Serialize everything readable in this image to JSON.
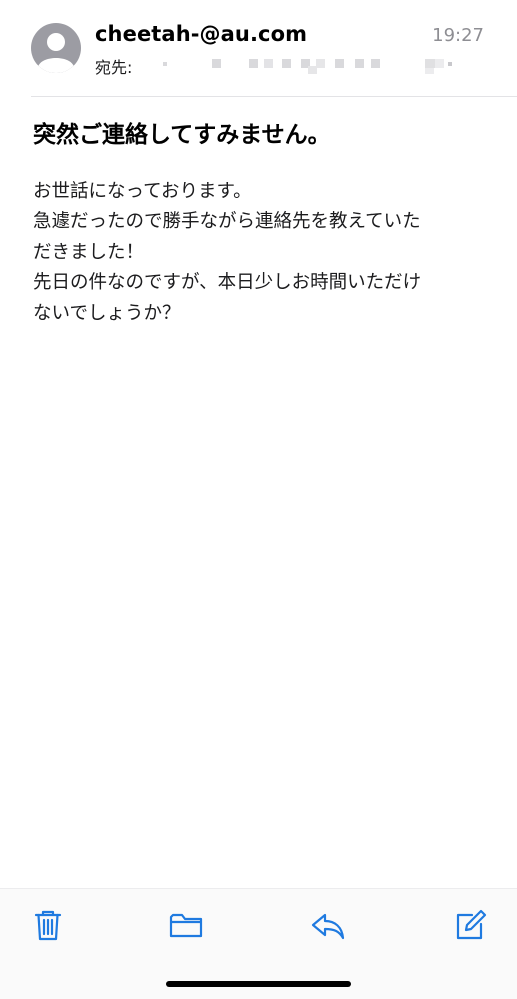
{
  "message": {
    "sender": "cheetah-@au.com",
    "time": "19:27",
    "recipient_label": "宛先:",
    "subject": "突然ご連絡してすみません。",
    "body_lines": [
      "お世話になっております。",
      "急遽だったので勝手ながら連絡先を教えていた",
      "だきました！",
      "先日の件なのですが、本日少しお時間いただけ",
      "ないでしょうか？"
    ]
  },
  "toolbar": {
    "icons": [
      "trash-icon",
      "folder-icon",
      "reply-icon",
      "compose-icon"
    ]
  },
  "colors": {
    "accent": "#1f7ae0",
    "avatar": "#9c9ca3",
    "secondary_text": "#8e8e93"
  }
}
